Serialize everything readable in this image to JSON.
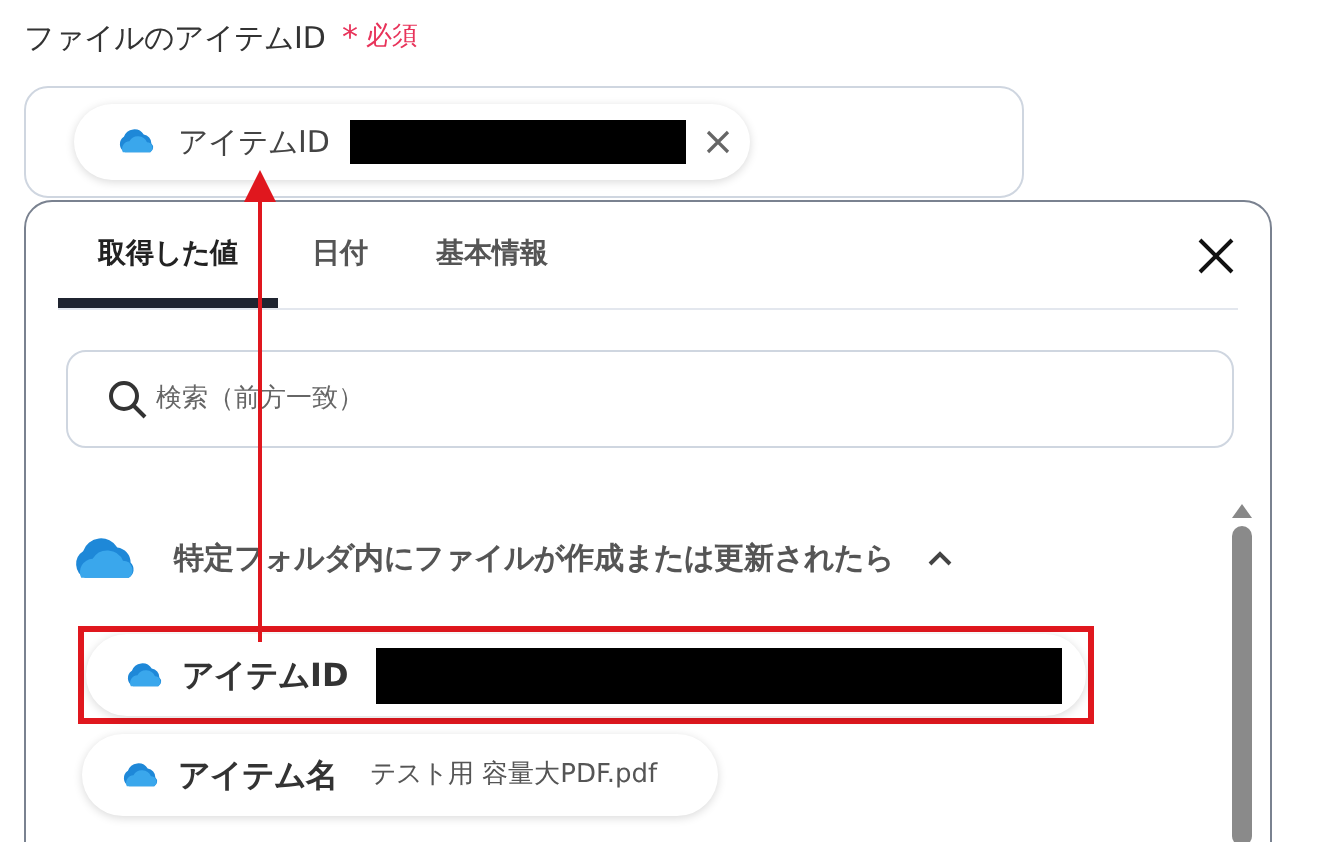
{
  "field": {
    "label": "ファイルのアイテムID",
    "required_mark": "*",
    "required_text": "必須",
    "chip": {
      "label": "アイテムID"
    }
  },
  "popover": {
    "tabs": [
      {
        "label": "取得した値",
        "selected": true
      },
      {
        "label": "日付",
        "selected": false
      },
      {
        "label": "基本情報",
        "selected": false
      }
    ],
    "search": {
      "placeholder": "検索（前方一致）"
    },
    "group": {
      "title": "特定フォルダ内にファイルが作成または更新されたら",
      "expanded": true,
      "items": [
        {
          "label": "アイテムID",
          "highlighted": true
        },
        {
          "label": "アイテム名",
          "value": "テスト用 容量大PDF.pdf",
          "highlighted": false
        }
      ]
    }
  }
}
